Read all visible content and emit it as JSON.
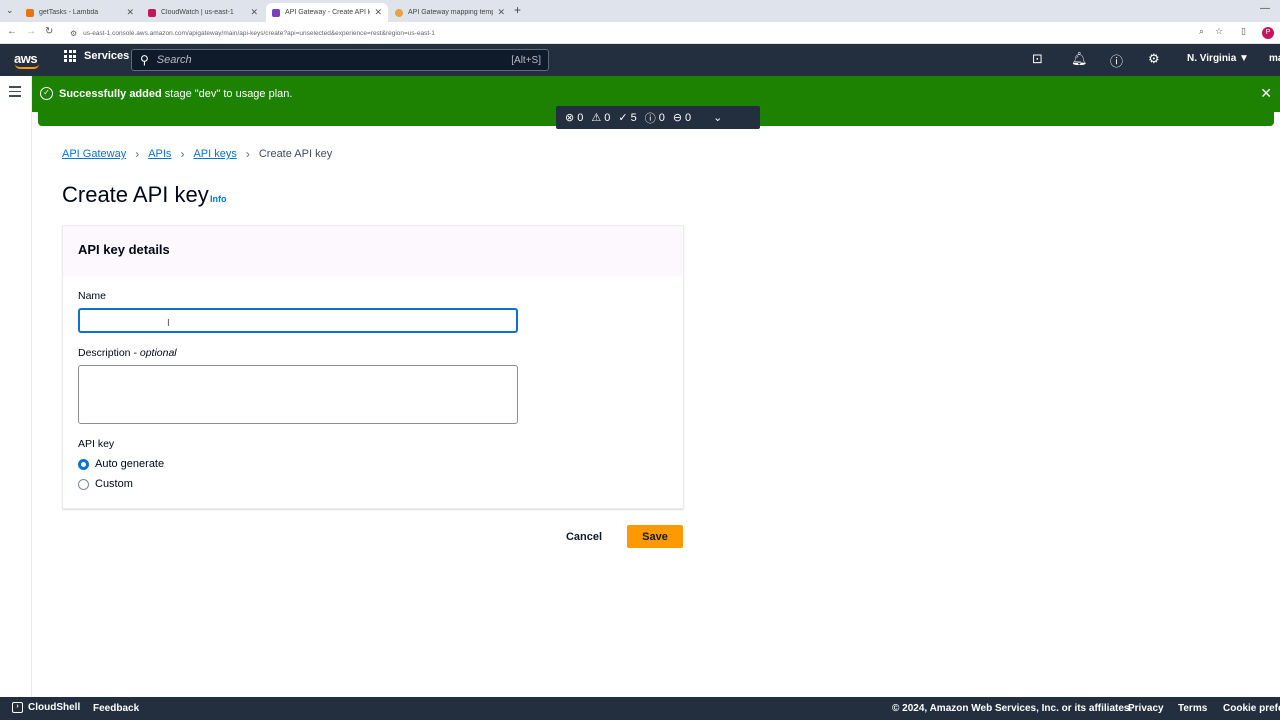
{
  "browser": {
    "tabs": [
      {
        "title": "getTasks - Lambda",
        "color": "#e8750f"
      },
      {
        "title": "CloudWatch | us-east-1",
        "color": "#c2185b"
      },
      {
        "title": "API Gateway - Create API key",
        "color": "#7b3fbf"
      },
      {
        "title": "API Gateway mapping templat...",
        "color": "#e8a33d"
      }
    ],
    "url": "us-east-1.console.aws.amazon.com/apigateway/main/api-keys/create?api=unselected&experience=rest&region=us-east-1",
    "profile_initial": "P"
  },
  "aws_nav": {
    "logo": "aws",
    "services_label": "Services",
    "search_placeholder": "Search",
    "search_shortcut": "[Alt+S]",
    "region": "N. Virginia ▼",
    "account": "ma"
  },
  "flash": {
    "bold": "Successfully added",
    "rest": " stage \"dev\" to usage plan."
  },
  "counter": {
    "errors": "0",
    "warnings": "0",
    "success": "5",
    "info": "0",
    "blocked": "0"
  },
  "breadcrumb": {
    "items": [
      "API Gateway",
      "APIs",
      "API keys"
    ],
    "current": "Create API key"
  },
  "page": {
    "title": "Create API key",
    "info_link": "Info"
  },
  "form": {
    "section_title": "API key details",
    "name_label": "Name",
    "name_value": "",
    "description_label": "Description - ",
    "description_optional": "optional",
    "description_value": "",
    "api_key_label": "API key",
    "options": [
      "Auto generate",
      "Custom"
    ],
    "selected_option": "Auto generate"
  },
  "actions": {
    "cancel": "Cancel",
    "save": "Save"
  },
  "footer": {
    "cloudshell": "CloudShell",
    "feedback": "Feedback",
    "copyright": "© 2024, Amazon Web Services, Inc. or its affiliates.",
    "privacy": "Privacy",
    "terms": "Terms",
    "cookie": "Cookie prefer"
  },
  "colors": {
    "success_green": "#1d8102",
    "nav_dark": "#232f3e",
    "link_blue": "#0972d3",
    "primary_orange": "#ff9900"
  }
}
